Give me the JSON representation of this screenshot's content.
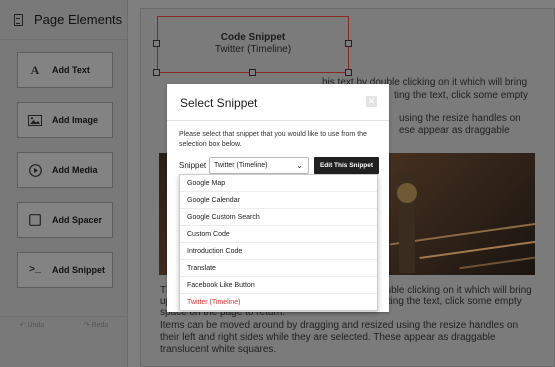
{
  "sidebar": {
    "title": "Page Elements",
    "items": [
      {
        "label": "Add Text",
        "icon": "A"
      },
      {
        "label": "Add Image",
        "icon": "image-icon"
      },
      {
        "label": "Add Media",
        "icon": "play-icon"
      },
      {
        "label": "Add Spacer",
        "icon": "square-icon"
      },
      {
        "label": "Add Snippet",
        "icon": ">_"
      }
    ],
    "undo_label": "Undo",
    "redo_label": "Redo"
  },
  "canvas": {
    "selected_block": {
      "title": "Code Snippet",
      "subtitle": "Twitter (Timeline)"
    },
    "text_top_1": "his text by double clicking on it which will bring",
    "text_top_2": "ting the text, click some empty",
    "text_top_3": "using the resize handles on",
    "text_top_4": "ese appear as draggable",
    "paragraph_1": "This text by double clicking on it which will bring up the text editing window. When finished editing the text, click some empty space on the page to return.",
    "paragraph_1_left": "This",
    "paragraph_1_right": "ouble clicking on it which will bring",
    "paragraph_1_left2": "up th",
    "paragraph_1_right2": "diting the text, click some empty",
    "paragraph_1_line3": "space on the page to return.",
    "paragraph_2_line1": "Items can be moved around by dragging and resized using the resize handles on",
    "paragraph_2_line2": "their left and right sides while they are selected. These appear as draggable",
    "paragraph_2_line3": "translucent white squares."
  },
  "modal": {
    "title": "Select Snippet",
    "close_icon": "close-icon",
    "description": "Please select that snippet that you would like to use from the selection box below.",
    "snippet_label": "Snippet",
    "selected_value": "Twitter (Timeline)",
    "edit_button": "Edit This Snippet"
  },
  "dropdown": {
    "options": [
      "Google Map",
      "Google Calendar",
      "Google Custom Search",
      "Custom Code",
      "Introduction Code",
      "Translate",
      "Facebook Like Button",
      "Twitter (Timeline)"
    ],
    "selected_color": "#dd3333"
  }
}
